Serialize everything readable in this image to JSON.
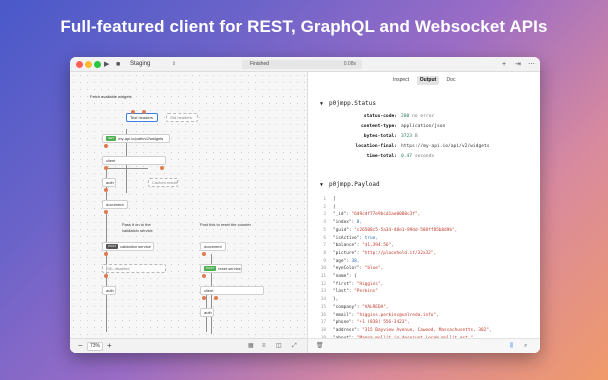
{
  "headline": "Full-featured client for REST, GraphQL and Websocket APIs",
  "colors": {
    "accent": "#3a7ee6",
    "node_dot": "#e07a4f",
    "badge_post": "#555555",
    "badge_get": "#4caf50"
  },
  "toolbar": {
    "run_icon": "play-icon",
    "stop_icon": "stop-icon",
    "environment": "Staging",
    "status": "Finished",
    "duration": "0.08s",
    "add_icon": "plus-icon",
    "send_icon": "arrow-icon",
    "menu_icon": "ellipsis-icon"
  },
  "canvas": {
    "labels": {
      "fetch_title": "Fetch available widgets",
      "pass_title_1": "Pass it on to the",
      "pass_title_2": "validation service",
      "post_title": "Post this to reset the counter"
    },
    "nodes": {
      "test_headers": "Test headers",
      "old_headers": "Old headers",
      "get_badge": "GET",
      "my_api": "my-api.io/path/v2/widgets",
      "client": "client",
      "auth": "auth",
      "cached_result": "Cached result",
      "document": "document",
      "post_badge": "POST",
      "validation_service": "validation service",
      "ssl_disabled": "SSL disabled",
      "auth2": "auth",
      "document2": "document",
      "reset_badge": "POST",
      "reset_service": "reset service",
      "client2": "client",
      "auth3": "auth"
    },
    "zoom": "73%"
  },
  "tabs": [
    {
      "label": "Inspect",
      "active": false
    },
    {
      "label": "Output",
      "active": true
    },
    {
      "label": "Doc",
      "active": false
    }
  ],
  "status_section": {
    "title": "p0jmpp.Status",
    "rows": [
      {
        "key": "status-code:",
        "value": "200",
        "extra": "no error"
      },
      {
        "key": "content-type:",
        "value": "application/json",
        "extra": ""
      },
      {
        "key": "bytes-total:",
        "value": "3723",
        "extra": "B"
      },
      {
        "key": "location-final:",
        "value": "https://my-api.io/api/v2/widgets",
        "extra": ""
      },
      {
        "key": "time-total:",
        "value": "0.47",
        "extra": "seconds"
      }
    ]
  },
  "payload_section": {
    "title": "p0jmpp.Payload",
    "lines": [
      {
        "n": "1",
        "text": "["
      },
      {
        "n": "2",
        "text": "  {"
      },
      {
        "n": "3",
        "text": "    \"_id\": \"6d9cdf77e9bcd1ae0008c3f\","
      },
      {
        "n": "4",
        "text": "    \"index\": 0,"
      },
      {
        "n": "5",
        "text": "    \"guid\": \"c26508c5-5a34-48e1-99dd-580ff85b8d9b\","
      },
      {
        "n": "6",
        "text": "    \"isActive\": true,"
      },
      {
        "n": "7",
        "text": "    \"balance\": \"$1,394.56\","
      },
      {
        "n": "8",
        "text": "    \"picture\": \"http://placehold.it/32x32\","
      },
      {
        "n": "9",
        "text": "    \"age\": 38,"
      },
      {
        "n": "10",
        "text": "    \"eyeColor\": \"blue\","
      },
      {
        "n": "11",
        "text": "    \"name\": {"
      },
      {
        "n": "12",
        "text": "      \"first\": \"Higgins\","
      },
      {
        "n": "13",
        "text": "      \"last\": \"Perkins\""
      },
      {
        "n": "14",
        "text": "    },"
      },
      {
        "n": "15",
        "text": "    \"company\": \"VALREDA\","
      },
      {
        "n": "16",
        "text": "    \"email\": \"higgins.perkins@valreda.info\","
      },
      {
        "n": "17",
        "text": "    \"phone\": \"+1 (838) 556-3423\","
      },
      {
        "n": "18",
        "text": "    \"address\": \"315 Bayview Avenue, Cawood, Massachusetts, 302\","
      },
      {
        "n": "19",
        "text": "    \"about\": \"Magna mollit in deserunt Lorem mollit est.\""
      }
    ]
  }
}
